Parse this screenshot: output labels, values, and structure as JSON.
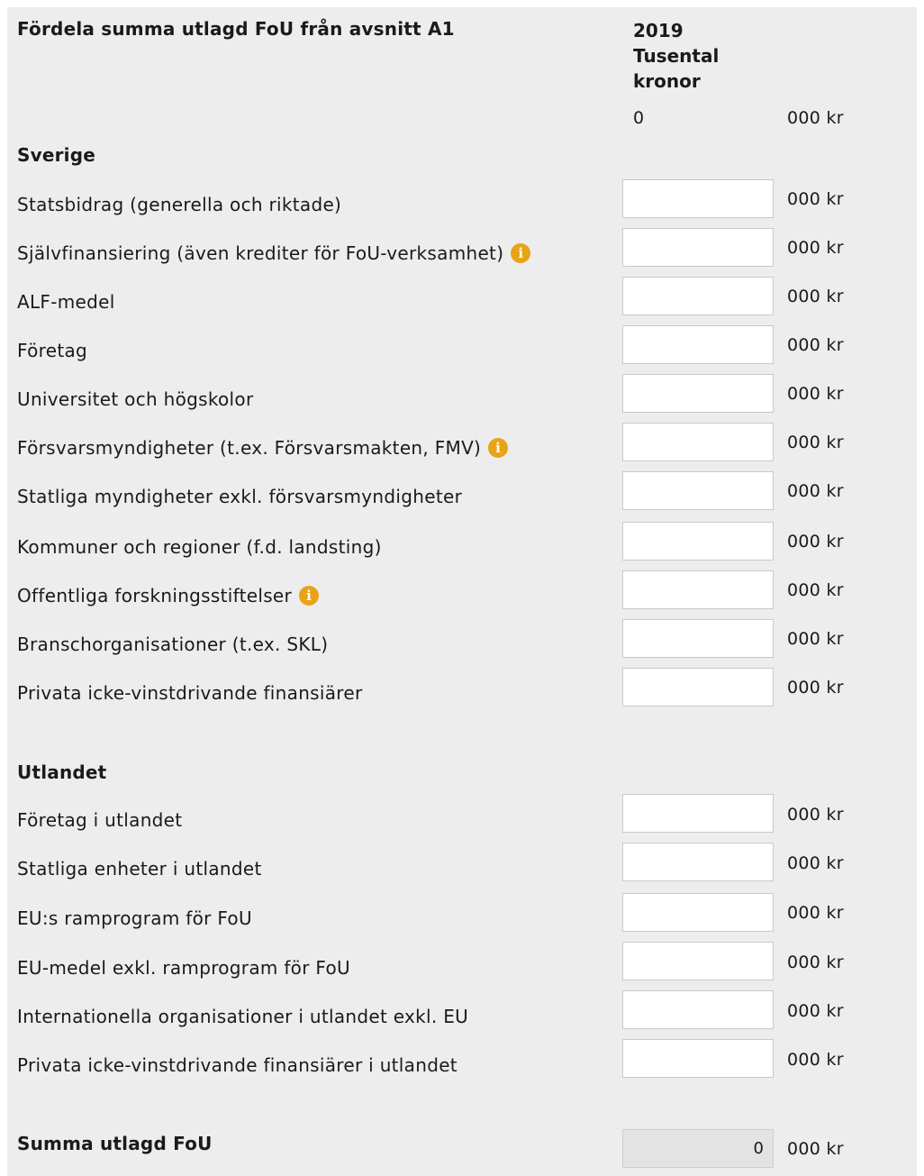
{
  "header": {
    "title": "Fördela summa utlagd FoU från avsnitt A1",
    "year": "2019",
    "unit_line1": "Tusental",
    "unit_line2": "kronor",
    "total_value": "0",
    "total_unit": "000 kr"
  },
  "sverige": {
    "heading": "Sverige",
    "rows": [
      {
        "label": "Statsbidrag (generella och riktade)",
        "value": "",
        "unit": "000 kr"
      },
      {
        "label": "Självfinansiering (även krediter för FoU-verksamhet)",
        "value": "",
        "unit": "000 kr",
        "info_icon": "info-icon"
      },
      {
        "label": "ALF-medel",
        "value": "",
        "unit": "000 kr"
      },
      {
        "label": "Företag",
        "value": "",
        "unit": "000 kr"
      },
      {
        "label": "Universitet och högskolor",
        "value": "",
        "unit": "000 kr"
      },
      {
        "label": "Försvarsmyndigheter (t.ex. Försvarsmakten, FMV)",
        "value": "",
        "unit": "000 kr",
        "info_icon": "info-icon"
      },
      {
        "label": "Statliga myndigheter exkl. försvarsmyndigheter",
        "value": "",
        "unit": "000 kr"
      },
      {
        "label": "Kommuner och regioner (f.d. landsting)",
        "value": "",
        "unit": "000 kr"
      },
      {
        "label": "Offentliga forskningsstiftelser",
        "value": "",
        "unit": "000 kr",
        "info_icon": "info-icon"
      },
      {
        "label": "Branschorganisationer (t.ex. SKL)",
        "value": "",
        "unit": "000 kr"
      },
      {
        "label": "Privata icke-vinstdrivande finansiärer",
        "value": "",
        "unit": "000 kr"
      }
    ]
  },
  "utlandet": {
    "heading": "Utlandet",
    "rows": [
      {
        "label": "Företag i utlandet",
        "value": "",
        "unit": "000 kr"
      },
      {
        "label": "Statliga enheter i utlandet",
        "value": "",
        "unit": "000 kr"
      },
      {
        "label": "EU:s ramprogram för FoU",
        "value": "",
        "unit": "000 kr"
      },
      {
        "label": "EU-medel exkl. ramprogram för FoU",
        "value": "",
        "unit": "000 kr"
      },
      {
        "label": "Internationella organisationer i utlandet exkl. EU",
        "value": "",
        "unit": "000 kr"
      },
      {
        "label": "Privata icke-vinstdrivande finansiärer i utlandet",
        "value": "",
        "unit": "000 kr"
      }
    ]
  },
  "summary": {
    "label": "Summa utlagd FoU",
    "value": "0",
    "unit": "000 kr"
  },
  "colors": {
    "panel_bg": "#ededed",
    "info_icon": "#e8a317",
    "readonly_bg": "#e3e3e3"
  }
}
